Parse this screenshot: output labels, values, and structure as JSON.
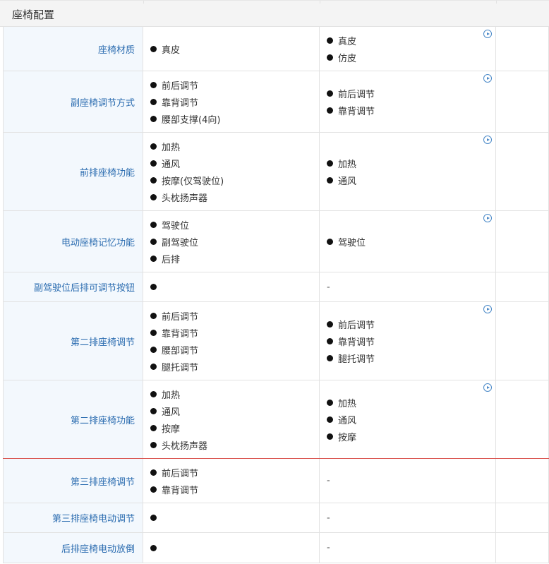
{
  "section": {
    "title": "座椅配置"
  },
  "rows": [
    {
      "label": "座椅材质",
      "col1": [
        "真皮"
      ],
      "col2": [
        "真皮",
        "仿皮"
      ],
      "col2_icon": true,
      "h": 63
    },
    {
      "label": "副座椅调节方式",
      "col1": [
        "前后调节",
        "靠背调节",
        "腰部支撑(4向)"
      ],
      "col2": [
        "前后调节",
        "靠背调节"
      ],
      "col2_icon": true,
      "h": 87
    },
    {
      "label": "前排座椅功能",
      "col1": [
        "加热",
        "通风",
        "按摩(仅驾驶位)",
        "头枕扬声器"
      ],
      "col2": [
        "加热",
        "通风"
      ],
      "col2_icon": true,
      "h": 111
    },
    {
      "label": "电动座椅记忆功能",
      "col1": [
        "驾驶位",
        "副驾驶位",
        "后排"
      ],
      "col2": [
        "驾驶位"
      ],
      "col2_icon": true,
      "h": 87
    },
    {
      "label": "副驾驶位后排可调节按钮",
      "col1": [
        ""
      ],
      "col2_dash": "-",
      "col2_icon": false,
      "h": 42
    },
    {
      "label": "第二排座椅调节",
      "col1": [
        "前后调节",
        "靠背调节",
        "腰部调节",
        "腿托调节"
      ],
      "col2": [
        "前后调节",
        "靠背调节",
        "腿托调节"
      ],
      "col2_icon": true,
      "h": 111
    },
    {
      "label": "第二排座椅功能",
      "col1": [
        "加热",
        "通风",
        "按摩",
        "头枕扬声器"
      ],
      "col2": [
        "加热",
        "通风",
        "按摩"
      ],
      "col2_icon": true,
      "h": 111,
      "red": true
    },
    {
      "label": "第三排座椅调节",
      "col1": [
        "前后调节",
        "靠背调节"
      ],
      "col2_dash": "-",
      "col2_icon": false,
      "h": 63
    },
    {
      "label": "第三排座椅电动调节",
      "col1": [
        ""
      ],
      "col2_dash": "-",
      "col2_icon": false,
      "h": 42
    },
    {
      "label": "后排座椅电动放倒",
      "col1": [
        ""
      ],
      "col2_dash": "-",
      "col2_icon": false,
      "h": 43
    }
  ],
  "icons": {
    "play": "play-circle-icon",
    "bullet": "bullet-dot-icon"
  },
  "colors": {
    "label": "#2b6cb0",
    "label_bg": "#f3f8fd",
    "border": "#e2e2e2",
    "divider_red": "#d9534f",
    "icon": "#4a89c8"
  }
}
